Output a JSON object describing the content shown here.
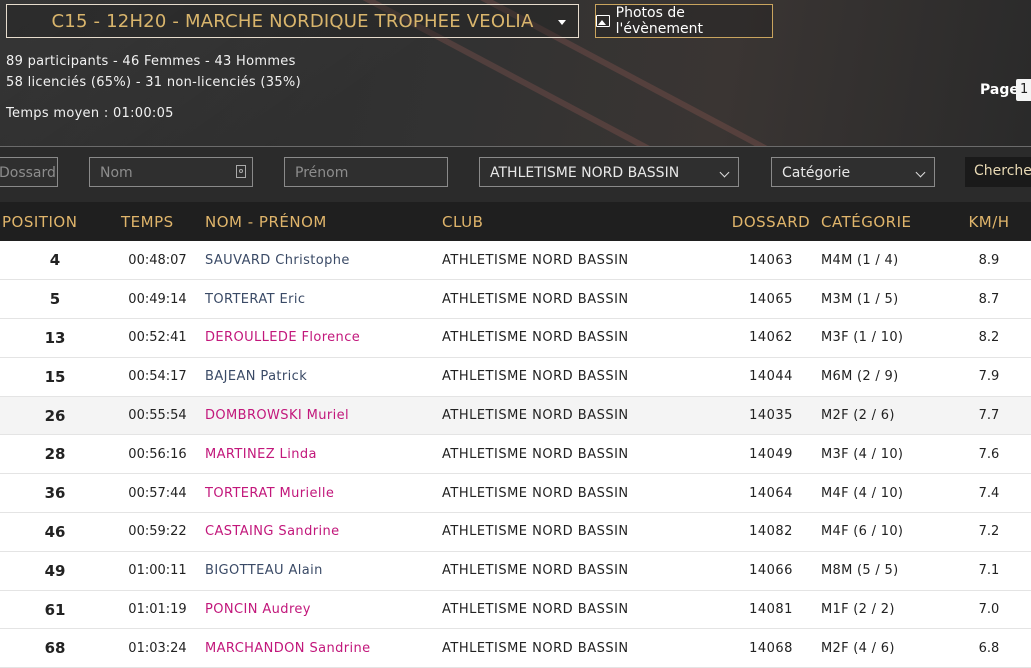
{
  "event": {
    "selected": "C15 - 12H20 - MARCHE NORDIQUE TROPHEE VEOLIA",
    "photos_label": "Photos de l'évènement"
  },
  "stats": {
    "participants": "89 participants - 46 Femmes - 43 Hommes",
    "licences": "58 licenciés (65%) - 31 non-licenciés (35%)",
    "average_time": "Temps moyen : 01:00:05"
  },
  "pagination": {
    "label": "Page",
    "current": "1"
  },
  "filters": {
    "bib_placeholder": "Dossard",
    "name_placeholder": "Nom",
    "firstname_placeholder": "Prénom",
    "club_selected": "ATHLETISME NORD BASSIN",
    "category_placeholder": "Catégorie",
    "search_label": "Chercher"
  },
  "table": {
    "headers": {
      "position": "POSITION",
      "time": "TEMPS",
      "name": "NOM - PRÉNOM",
      "club": "CLUB",
      "bib": "DOSSARD",
      "category": "CATÉGORIE",
      "speed": "KM/H"
    },
    "rows": [
      {
        "position": "4",
        "time": "00:48:07",
        "name": "SAUVARD Christophe",
        "gender": "m",
        "club": "ATHLETISME NORD BASSIN",
        "bib": "14063",
        "category": "M4M (1 / 4)",
        "speed": "8.9"
      },
      {
        "position": "5",
        "time": "00:49:14",
        "name": "TORTERAT Eric",
        "gender": "m",
        "club": "ATHLETISME NORD BASSIN",
        "bib": "14065",
        "category": "M3M (1 / 5)",
        "speed": "8.7"
      },
      {
        "position": "13",
        "time": "00:52:41",
        "name": "DEROULLEDE Florence",
        "gender": "f",
        "club": "ATHLETISME NORD BASSIN",
        "bib": "14062",
        "category": "M3F (1 / 10)",
        "speed": "8.2"
      },
      {
        "position": "15",
        "time": "00:54:17",
        "name": "BAJEAN Patrick",
        "gender": "m",
        "club": "ATHLETISME NORD BASSIN",
        "bib": "14044",
        "category": "M6M (2 / 9)",
        "speed": "7.9"
      },
      {
        "position": "26",
        "time": "00:55:54",
        "name": "DOMBROWSKI Muriel",
        "gender": "f",
        "club": "ATHLETISME NORD BASSIN",
        "bib": "14035",
        "category": "M2F (2 / 6)",
        "speed": "7.7"
      },
      {
        "position": "28",
        "time": "00:56:16",
        "name": "MARTINEZ Linda",
        "gender": "f",
        "club": "ATHLETISME NORD BASSIN",
        "bib": "14049",
        "category": "M3F (4 / 10)",
        "speed": "7.6"
      },
      {
        "position": "36",
        "time": "00:57:44",
        "name": "TORTERAT Murielle",
        "gender": "f",
        "club": "ATHLETISME NORD BASSIN",
        "bib": "14064",
        "category": "M4F (4 / 10)",
        "speed": "7.4"
      },
      {
        "position": "46",
        "time": "00:59:22",
        "name": "CASTAING Sandrine",
        "gender": "f",
        "club": "ATHLETISME NORD BASSIN",
        "bib": "14082",
        "category": "M4F (6 / 10)",
        "speed": "7.2"
      },
      {
        "position": "49",
        "time": "01:00:11",
        "name": "BIGOTTEAU Alain",
        "gender": "m",
        "club": "ATHLETISME NORD BASSIN",
        "bib": "14066",
        "category": "M8M (5 / 5)",
        "speed": "7.1"
      },
      {
        "position": "61",
        "time": "01:01:19",
        "name": "PONCIN Audrey",
        "gender": "f",
        "club": "ATHLETISME NORD BASSIN",
        "bib": "14081",
        "category": "M1F (2 / 2)",
        "speed": "7.0"
      },
      {
        "position": "68",
        "time": "01:03:24",
        "name": "MARCHANDON Sandrine",
        "gender": "f",
        "club": "ATHLETISME NORD BASSIN",
        "bib": "14068",
        "category": "M2F (4 / 6)",
        "speed": "6.8"
      }
    ]
  },
  "colors": {
    "accent_gold": "#e0b56b",
    "male_name": "#3a4a66",
    "female_name": "#c2177b",
    "header_bg": "#1f1f1f"
  }
}
